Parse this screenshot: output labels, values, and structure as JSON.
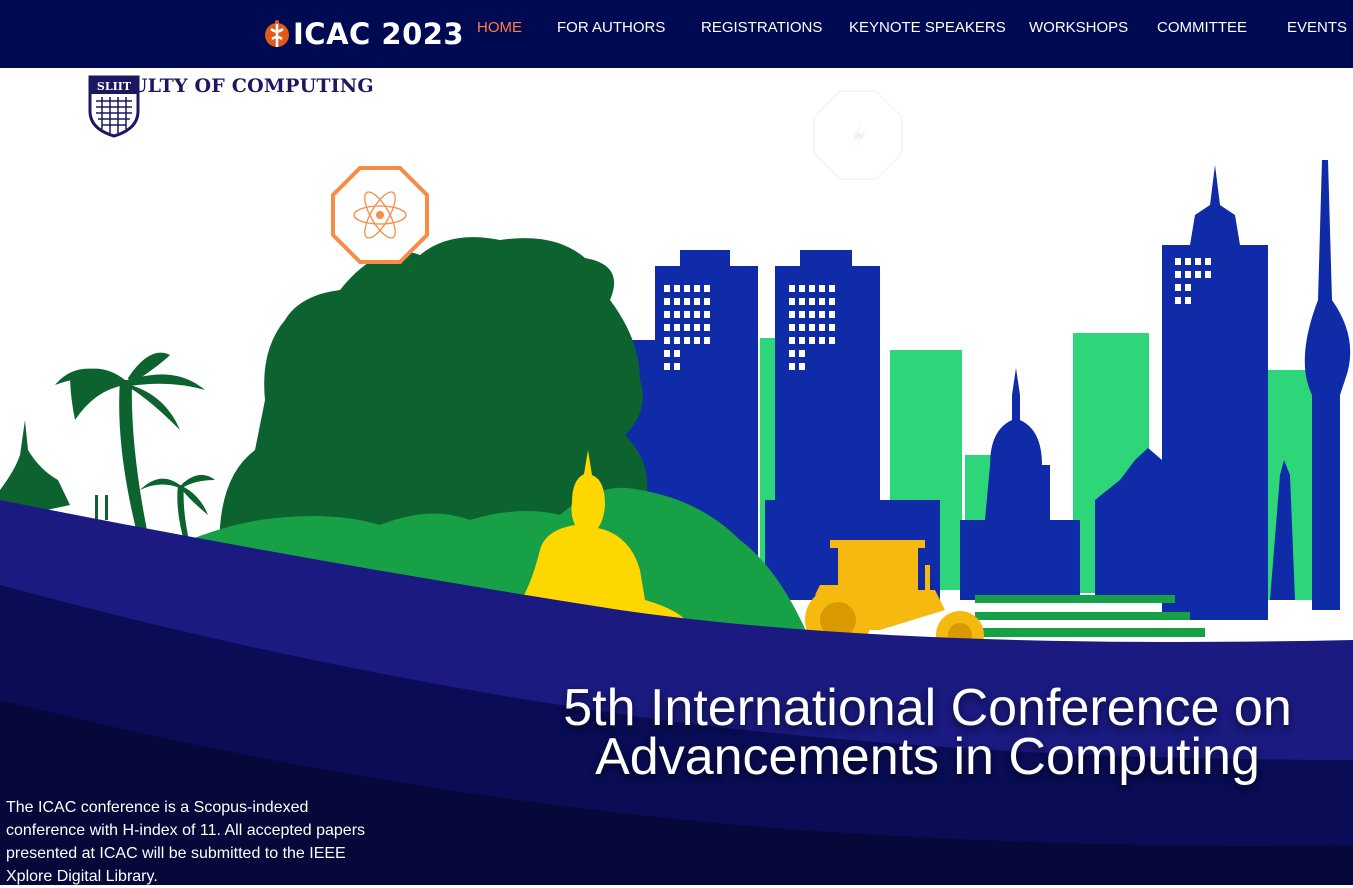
{
  "nav": {
    "brand": "ICAC 2023",
    "items": [
      {
        "label": "HOME",
        "active": true
      },
      {
        "label": "FOR AUTHORS",
        "active": false
      },
      {
        "label": "REGISTRATIONS",
        "active": false
      },
      {
        "label": "KEYNOTE SPEAKERS",
        "active": false
      },
      {
        "label": "WORKSHOPS",
        "active": false
      },
      {
        "label": "COMMITTEE",
        "active": false
      },
      {
        "label": "EVENTS",
        "active": false
      }
    ]
  },
  "hero": {
    "faculty": {
      "emblem_text": "SLIIT",
      "name": "FACULTY OF COMPUTING"
    },
    "title_line1": "5th International Conference on",
    "title_line2": "Advancements in Computing",
    "description": "The ICAC conference is a Scopus-indexed conference with H-index of 11. All accepted papers presented at ICAC will be submitted to the IEEE Xplore Digital Library."
  },
  "icons": [
    "icac-logo-icon",
    "sliit-crest-icon",
    "atom-icon",
    "lightning-icon"
  ],
  "colors": {
    "navbar": "#000a52",
    "active_nav": "#ff7a47",
    "city_blue": "#0f2ba8",
    "light_green": "#2ed67a",
    "forest_green": "#0d6330",
    "hill_green": "#17a045",
    "buddha_yellow": "#ffd700",
    "tractor_orange": "#f5b90f",
    "banner_navy": "#0a0c55"
  }
}
